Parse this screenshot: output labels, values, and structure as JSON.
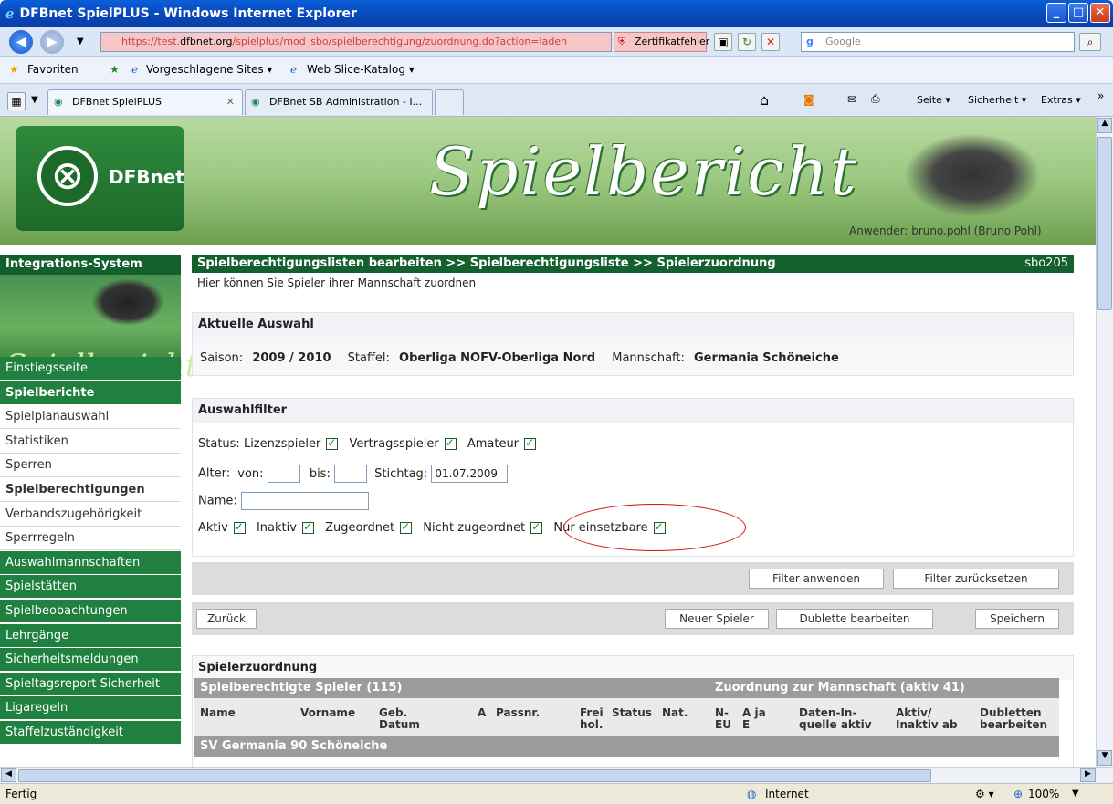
{
  "window": {
    "title": "DFBnet SpielPLUS - Windows Internet Explorer"
  },
  "browser": {
    "url_prefix": "https://test.",
    "url_domain": "dfbnet.org",
    "url_path": "/spielplus/mod_sbo/spielberechtigung/zuordnung.do?action=laden",
    "cert_error": "Zertifikatfehler",
    "search_placeholder": "Google",
    "favorites_label": "Favoriten",
    "fav_links": [
      "Vorgeschlagene Sites ▾",
      "Web Slice-Katalog ▾"
    ],
    "tabs": [
      "DFBnet SpielPLUS",
      "DFBnet SB Administration - I..."
    ],
    "tools": [
      "Seite ▾",
      "Sicherheit ▾",
      "Extras ▾"
    ],
    "status_left": "Fertig",
    "status_zone": "Internet",
    "zoom": "100%"
  },
  "header": {
    "logo_text": "DFBnet",
    "banner_title": "Spielbericht",
    "user_line": "Anwender: bruno.pohl (Bruno Pohl)"
  },
  "sidebar": {
    "title": "Integrations-System",
    "image_text": "Spielbericht",
    "items": [
      {
        "label": "Einstiegsseite",
        "style": "green"
      },
      {
        "label": "Spielberichte",
        "style": "green bold"
      },
      {
        "label": "Spielplanauswahl",
        "style": "white"
      },
      {
        "label": "Statistiken",
        "style": "white"
      },
      {
        "label": "Sperren",
        "style": "white"
      },
      {
        "label": "Spielberechtigungen",
        "style": "white bold"
      },
      {
        "label": "Verbandszugehörigkeit",
        "style": "white"
      },
      {
        "label": "Sperrregeln",
        "style": "white"
      },
      {
        "label": "Auswahlmannschaften",
        "style": "green"
      },
      {
        "label": "Spielstätten",
        "style": "green"
      },
      {
        "label": "Spielbeobachtungen",
        "style": "green"
      },
      {
        "label": "Lehrgänge",
        "style": "green"
      },
      {
        "label": "Sicherheitsmeldungen",
        "style": "green"
      },
      {
        "label": "Spieltagsreport Sicherheit",
        "style": "green"
      },
      {
        "label": "Ligaregeln",
        "style": "green"
      },
      {
        "label": "Staffelzuständigkeit",
        "style": "green"
      }
    ]
  },
  "main": {
    "breadcrumb": "Spielberechtigungslisten bearbeiten >> Spielberechtigungsliste >> Spielerzuordnung",
    "page_code": "sbo205",
    "hint": "Hier können Sie Spieler ihrer Mannschaft zuordnen",
    "selection": {
      "title": "Aktuelle Auswahl",
      "season_label": "Saison:",
      "season_value": "2009 / 2010",
      "staffel_label": "Staffel:",
      "staffel_value": "Oberliga NOFV-Oberliga Nord",
      "team_label": "Mannschaft:",
      "team_value": "Germania Schöneiche"
    },
    "filter": {
      "title": "Auswahlfilter",
      "status_label": "Status:",
      "status_options": [
        "Lizenzspieler",
        "Vertragsspieler",
        "Amateur"
      ],
      "age_label": "Alter:",
      "from_label": "von:",
      "to_label": "bis:",
      "ref_date_label": "Stichtag:",
      "ref_date_value": "01.07.2009",
      "name_label": "Name:",
      "flags": [
        "Aktiv",
        "Inaktiv",
        "Zugeordnet",
        "Nicht zugeordnet",
        "Nur einsetzbare"
      ],
      "apply_button": "Filter anwenden",
      "reset_button": "Filter zurücksetzen"
    },
    "actions": {
      "back": "Zurück",
      "new_player": "Neuer Spieler",
      "edit_duplicate": "Dublette bearbeiten",
      "save": "Speichern"
    },
    "assignment": {
      "title": "Spielerzuordnung",
      "left_header": "Spielberechtigte Spieler (115)",
      "right_header": "Zuordnung zur Mannschaft (aktiv 41)",
      "columns": [
        "Name",
        "Vorname",
        "Geb. Datum",
        "A",
        "Passnr.",
        "Frei hol.",
        "Status",
        "Nat.",
        "N-EU",
        "A ja E",
        "Daten-In-quelle aktiv",
        "Aktiv/ Inaktiv ab",
        "Dubletten bearbeiten"
      ],
      "group": "SV Germania 90 Schöneiche"
    }
  }
}
